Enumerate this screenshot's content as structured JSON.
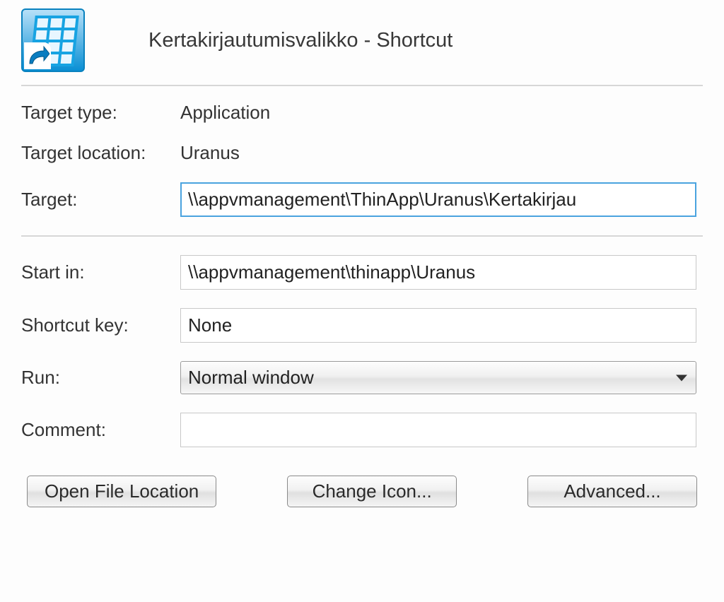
{
  "header": {
    "title": "Kertakirjautumisvalikko - Shortcut",
    "iconName": "shortcut-app-icon"
  },
  "fields": {
    "targetTypeLabel": "Target type:",
    "targetTypeValue": "Application",
    "targetLocationLabel": "Target location:",
    "targetLocationValue": "Uranus",
    "targetLabel": "Target:",
    "targetValue": "\\\\appvmanagement\\ThinApp\\Uranus\\Kertakirjau",
    "startInLabel": "Start in:",
    "startInValue": "\\\\appvmanagement\\thinapp\\Uranus",
    "shortcutKeyLabel": "Shortcut key:",
    "shortcutKeyValue": "None",
    "runLabel": "Run:",
    "runValue": "Normal window",
    "commentLabel": "Comment:",
    "commentValue": ""
  },
  "buttons": {
    "openFileLocation": "Open File Location",
    "changeIcon": "Change Icon...",
    "advanced": "Advanced..."
  }
}
